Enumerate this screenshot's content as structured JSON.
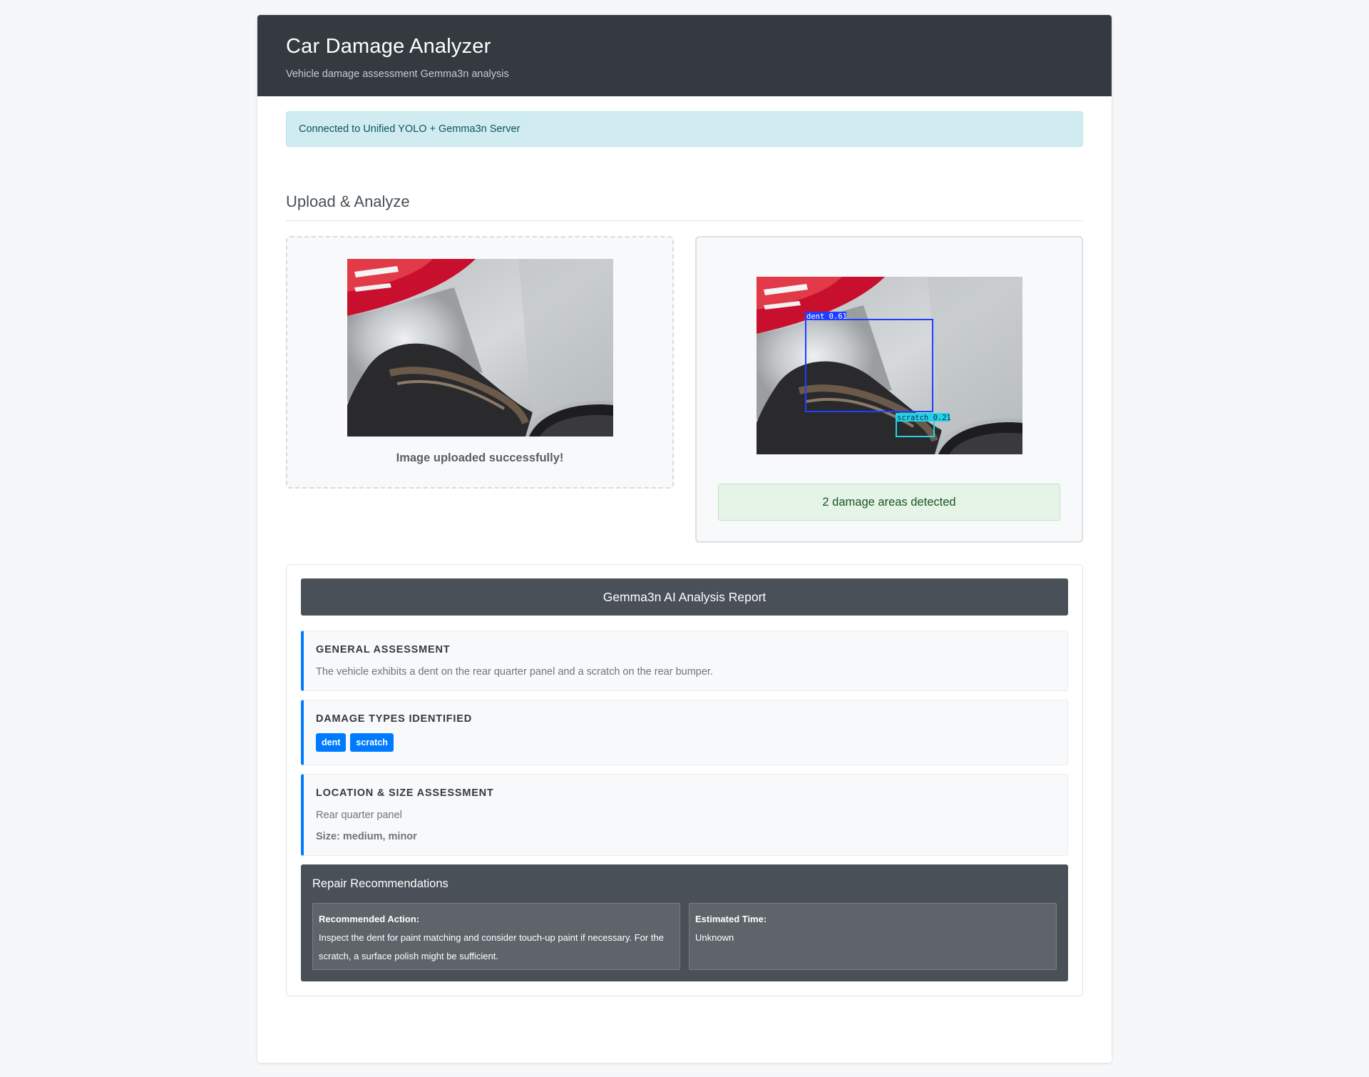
{
  "header": {
    "title": "Car Damage Analyzer",
    "subtitle": "Vehicle damage assessment Gemma3n analysis"
  },
  "status": {
    "message": "Connected to Unified YOLO + Gemma3n Server"
  },
  "upload_section": {
    "title": "Upload & Analyze",
    "upload_message": "Image uploaded successfully!",
    "detection_message": "2 damage areas detected",
    "detections": [
      {
        "label": "dent 0.61",
        "color": "#1f3fff"
      },
      {
        "label": "scratch 0.21",
        "color": "#22d3e6"
      }
    ]
  },
  "report": {
    "title": "Gemma3n AI Analysis Report",
    "general": {
      "heading": "GENERAL ASSESSMENT",
      "text": "The vehicle exhibits a dent on the rear quarter panel and a scratch on the rear bumper."
    },
    "damage_types": {
      "heading": "DAMAGE TYPES IDENTIFIED",
      "tags": [
        "dent",
        "scratch"
      ]
    },
    "location": {
      "heading": "LOCATION & SIZE ASSESSMENT",
      "text": "Rear quarter panel",
      "size": "Size: medium, minor"
    },
    "repair": {
      "heading": "Repair Recommendations",
      "action_label": "Recommended Action:",
      "action_text": "Inspect the dent for paint matching and consider touch-up paint if necessary. For the scratch, a surface polish might be sufficient.",
      "time_label": "Estimated Time:",
      "time_text": "Unknown"
    }
  },
  "colors": {
    "header_bg": "#343a40",
    "accent": "#007bff",
    "success_bg": "#e6f3e7",
    "info_bg": "#d1ecf1"
  }
}
